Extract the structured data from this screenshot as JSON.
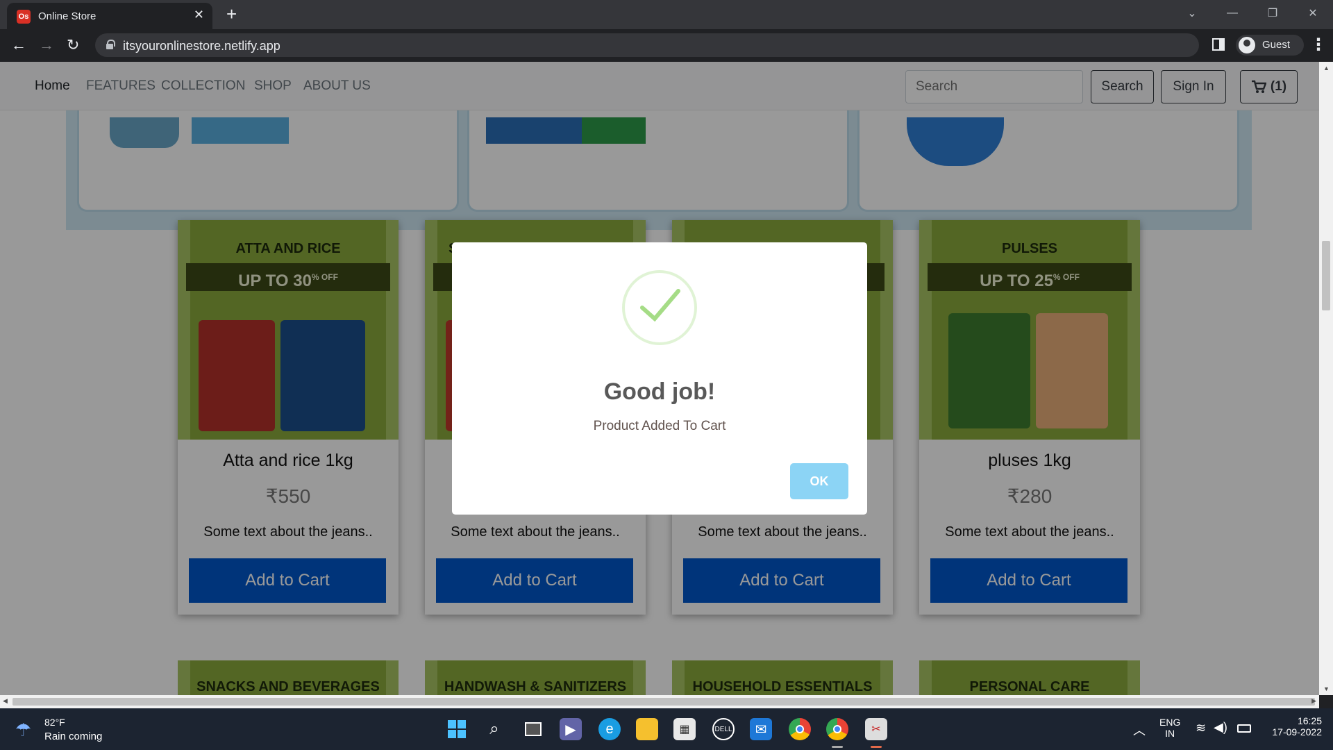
{
  "browser": {
    "tab_title": "Online Store",
    "url": "itsyouronlinestore.netlify.app",
    "profile": "Guest"
  },
  "navbar": {
    "links": [
      "Home",
      "FEATURES",
      "COLLECTION",
      "SHOP",
      "ABOUT US"
    ],
    "search_placeholder": "Search",
    "search_button": "Search",
    "signin_button": "Sign In",
    "cart_count": "(1)"
  },
  "products": [
    {
      "banner": "ATTA AND RICE",
      "offer": "UP TO 30",
      "offer_suffix": "% OFF",
      "name": "Atta and rice 1kg",
      "price": "₹550",
      "desc": "Some text about the jeans..",
      "button": "Add to Cart"
    },
    {
      "banner": "S",
      "offer": "",
      "offer_suffix": "",
      "name": "",
      "price": "",
      "desc": "Some text about the jeans..",
      "button": "Add to Cart"
    },
    {
      "banner": "",
      "offer": "",
      "offer_suffix": "",
      "name": "",
      "price": "",
      "desc": "Some text about the jeans..",
      "button": "Add to Cart"
    },
    {
      "banner": "PULSES",
      "offer": "UP TO 25",
      "offer_suffix": "% OFF",
      "name": "pluses 1kg",
      "price": "₹280",
      "desc": "Some text about the jeans..",
      "button": "Add to Cart"
    }
  ],
  "next_row": [
    "SNACKS AND BEVERAGES",
    "HANDWASH & SANITIZERS",
    "HOUSEHOLD ESSENTIALS",
    "PERSONAL CARE"
  ],
  "modal": {
    "title": "Good job!",
    "text": "Product Added To Cart",
    "ok": "OK"
  },
  "taskbar": {
    "temp": "82°F",
    "weather": "Rain coming",
    "lang": "ENG",
    "region": "IN",
    "time": "16:25",
    "date": "17-09-2022"
  },
  "colors": {
    "primary_button": "#0058cc",
    "banner_green": "#8aaa3c",
    "modal_ok": "#8cd4f5",
    "success_check": "#a5dc86"
  }
}
